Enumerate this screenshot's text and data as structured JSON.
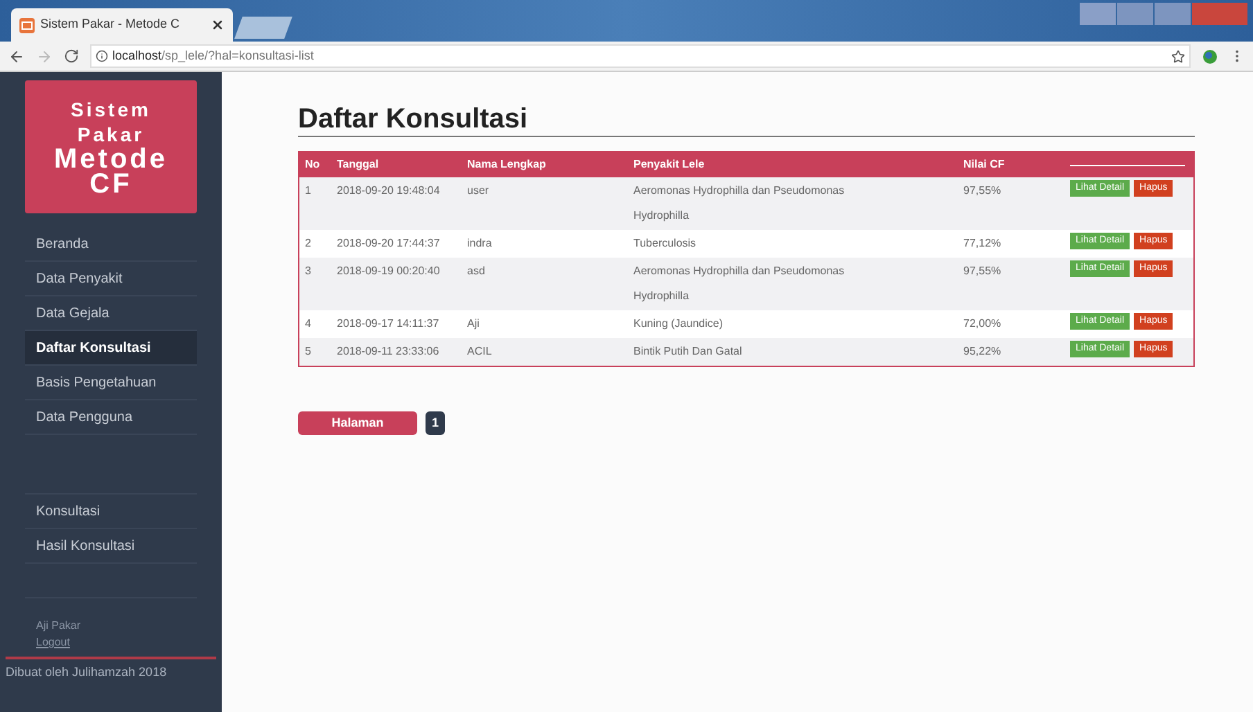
{
  "browser": {
    "tab_title": "Sistem Pakar - Metode C",
    "url_host": "localhost",
    "url_path": "/sp_lele/?hal=konsultasi-list"
  },
  "sidebar": {
    "logo_lines": [
      "Sistem",
      "Pakar",
      "Metode",
      "CF"
    ],
    "sections": [
      {
        "items": [
          {
            "label": "Beranda",
            "selected": false
          },
          {
            "label": "Data Penyakit",
            "selected": false
          },
          {
            "label": "Data Gejala",
            "selected": false
          },
          {
            "label": "Daftar Konsultasi",
            "selected": true
          },
          {
            "label": "Basis Pengetahuan",
            "selected": false
          },
          {
            "label": "Data Pengguna",
            "selected": false
          }
        ]
      },
      {
        "items": [
          {
            "label": "Konsultasi",
            "selected": false
          },
          {
            "label": "Hasil Konsultasi",
            "selected": false
          }
        ]
      }
    ],
    "user": "Aji Pakar",
    "logout": "Logout",
    "footer": "Dibuat oleh Julihamzah 2018"
  },
  "page_title": "Daftar Konsultasi",
  "table": {
    "columns": [
      "No",
      "Tanggal",
      "Nama Lengkap",
      "Penyakit Lele",
      "Nilai CF"
    ],
    "rows": [
      {
        "cells": [
          "1",
          "2018-09-20 19:48:04",
          "user",
          "Aeromonas Hydrophilla dan Pseudomonas Hydrophilla",
          "97,55%"
        ],
        "actions": [
          "Lihat Detail",
          "Hapus"
        ]
      },
      {
        "cells": [
          "2",
          "2018-09-20 17:44:37",
          "indra",
          "Tuberculosis",
          "77,12%"
        ],
        "actions": [
          "Lihat Detail",
          "Hapus"
        ]
      },
      {
        "cells": [
          "3",
          "2018-09-19 00:20:40",
          "asd",
          "Aeromonas Hydrophilla dan Pseudomonas Hydrophilla",
          "97,55%"
        ],
        "actions": [
          "Lihat Detail",
          "Hapus"
        ]
      },
      {
        "cells": [
          "4",
          "2018-09-17 14:11:37",
          "Aji",
          "Kuning (Jaundice)",
          "72,00%"
        ],
        "actions": [
          "Lihat Detail",
          "Hapus"
        ]
      },
      {
        "cells": [
          "5",
          "2018-09-11 23:33:06",
          "ACIL",
          "Bintik Putih Dan Gatal",
          "95,22%"
        ],
        "actions": [
          "Lihat Detail",
          "Hapus"
        ]
      }
    ]
  },
  "pagination": {
    "label": "Halaman",
    "pages": [
      {
        "label": "1",
        "selected": true
      }
    ]
  }
}
